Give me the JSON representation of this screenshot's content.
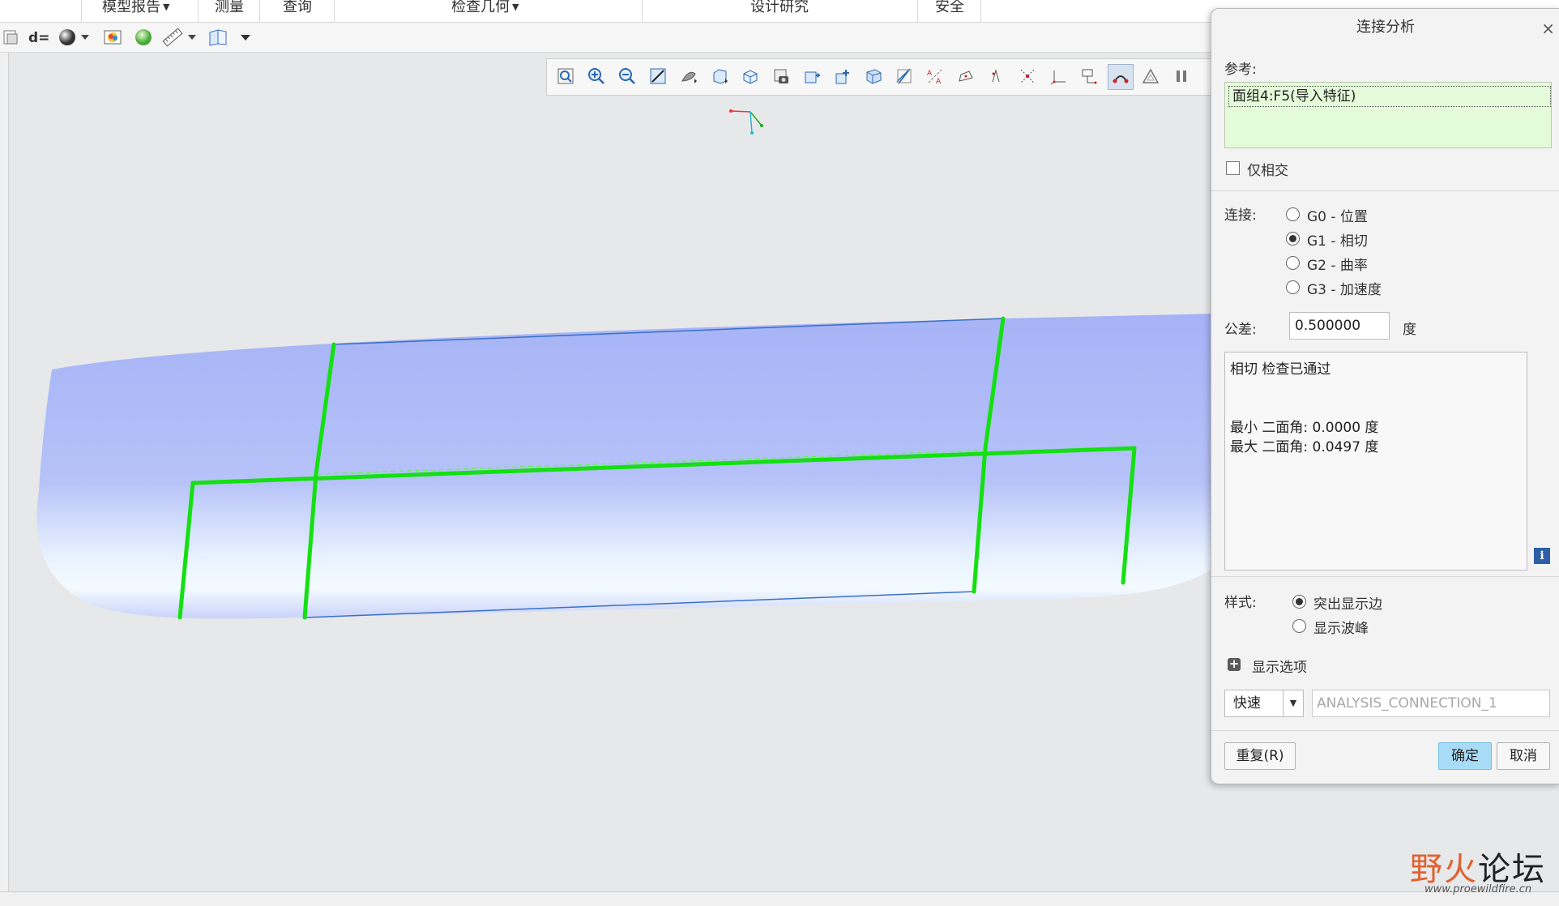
{
  "menubar": {
    "items": [
      {
        "label": "模型报告",
        "dropdown": true
      },
      {
        "label": "测量",
        "dropdown": false
      },
      {
        "label": "查询",
        "dropdown": false
      },
      {
        "label": "检查几何",
        "dropdown": true
      },
      {
        "label": "设计研究",
        "dropdown": false
      },
      {
        "label": "安全",
        "dropdown": false
      }
    ]
  },
  "toolbar": {
    "icons": [
      "new-icon",
      "dimension-icon",
      "sphere-icon",
      "color-map-icon",
      "green-sphere-icon",
      "ruler-icon",
      "book-icon",
      "more-icon"
    ]
  },
  "view_toolbar": {
    "icons": [
      "zoom-fit-icon",
      "zoom-in-icon",
      "zoom-out-icon",
      "repaint-icon",
      "shading-icon",
      "display-style-icon",
      "saved-views-icon",
      "camera-icon",
      "view-manager-icon",
      "spin-center-icon",
      "perspective-icon",
      "plane-display-icon",
      "axis-display-icon",
      "point-display-icon",
      "csys-display-icon",
      "annotation-icon",
      "csys-tag-icon",
      "connection-icon",
      "triangle-icon",
      "pause-icon"
    ],
    "active_index": 18
  },
  "model": {
    "surface_color": "#a9b6f7",
    "highlight_color": "#14e012",
    "edge_color": "#3a70c8"
  },
  "dialog": {
    "title": "连接分析",
    "close_glyph": "×",
    "reference_label": "参考:",
    "reference_item": "面组4:F5(导入特征)",
    "intersect_only_label": "仅相交",
    "intersect_only_checked": false,
    "connection_label": "连接:",
    "connection_options": [
      "G0 - 位置",
      "G1 - 相切",
      "G2 - 曲率",
      "G3 - 加速度"
    ],
    "connection_selected": 1,
    "tolerance_label": "公差:",
    "tolerance_value": "0.500000",
    "tolerance_unit": "度",
    "result": {
      "status": "相切 检查已通过",
      "min_angle": "最小 二面角: 0.0000 度",
      "max_angle": "最大 二面角: 0.0497 度"
    },
    "info_glyph": "i",
    "style_label": "样式:",
    "style_options": [
      "突出显示边",
      "显示波峰"
    ],
    "style_selected": 0,
    "display_options_label": "显示选项",
    "mode_value": "快速",
    "analysis_name": "ANALYSIS_CONNECTION_1",
    "repeat_button": "重复(R)",
    "ok_button": "确定",
    "cancel_button": "取消"
  },
  "watermark": {
    "text_colored": "野火",
    "text_dark": "论坛",
    "url": "www.proewildfire.cn"
  }
}
